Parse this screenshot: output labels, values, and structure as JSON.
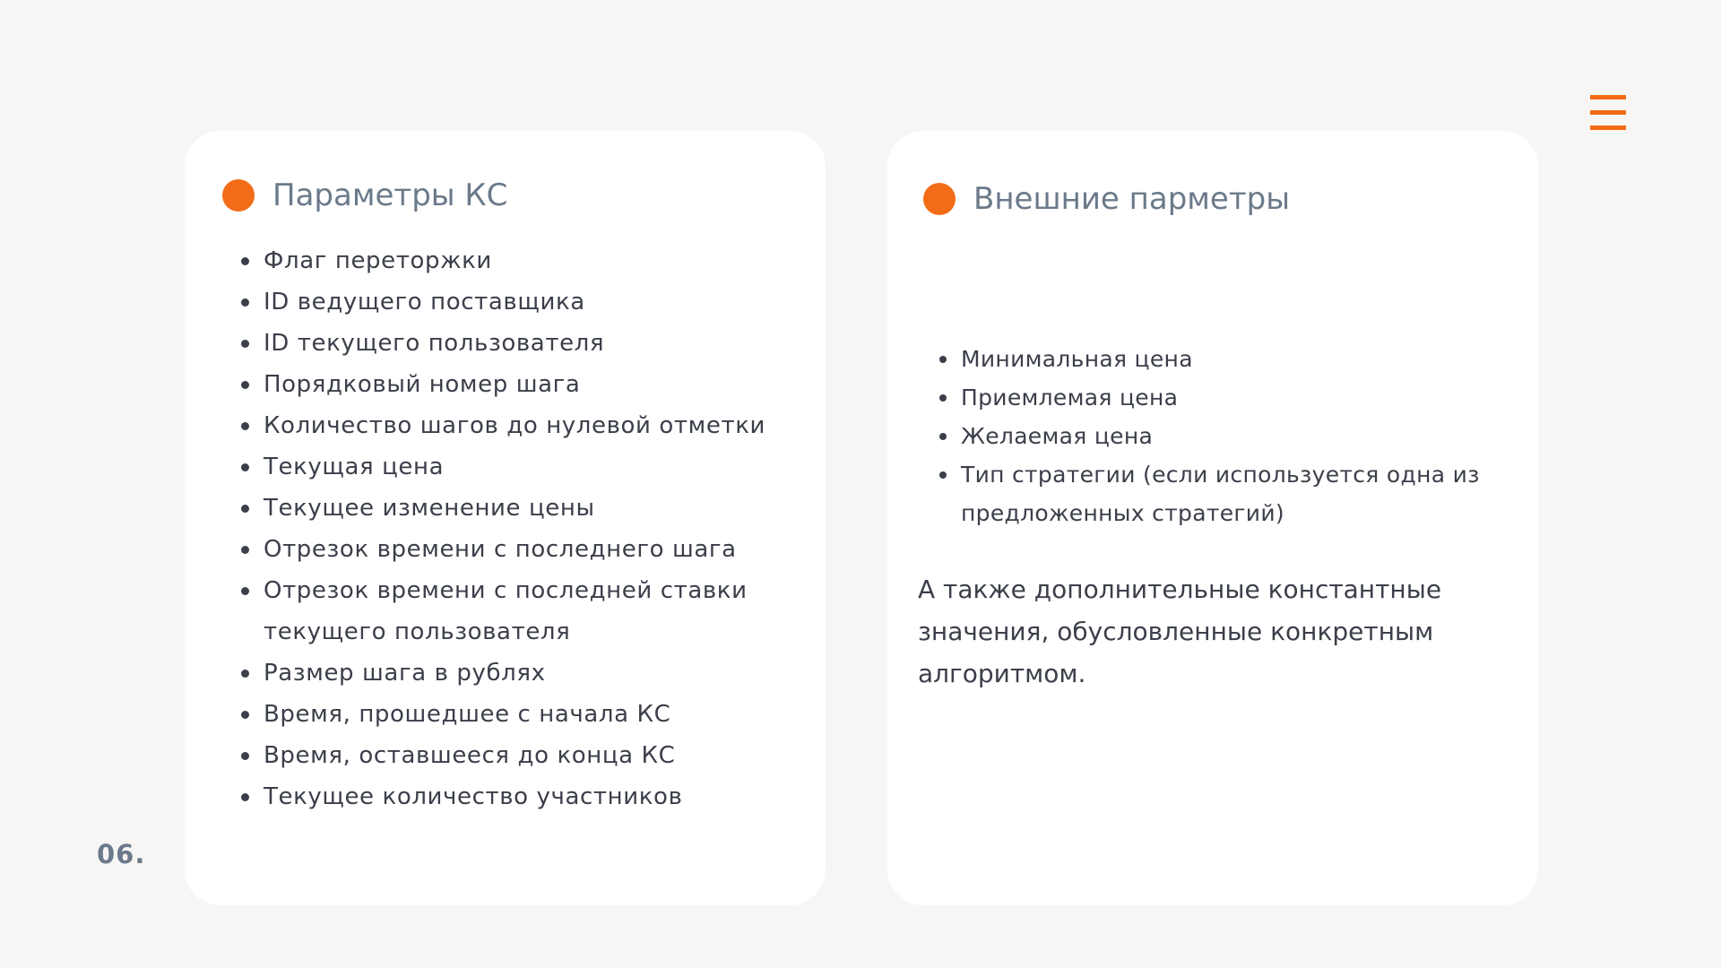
{
  "left_card": {
    "title": "Параметры КС",
    "items": [
      "Флаг переторжки",
      "ID ведущего поставщика",
      "ID текущего пользователя",
      "Порядковый номер шага",
      "Количество шагов до нулевой отметки",
      "Текущая цена",
      "Текущее изменение цены",
      "Отрезок времени с последнего шага",
      "Отрезок времени с последней ставки",
      "текущего пользователя",
      "Размер шага в рублях",
      "Время, прошедшее с начала КС",
      "Время, оставшееся до конца КС",
      "Текущее количество участников"
    ]
  },
  "right_card": {
    "title": "Внешние парметры",
    "items": [
      "Минимальная цена",
      "Приемлемая цена",
      "Желаемая цена",
      "Тип стратегии (если используется одна из",
      "предложенных стратегий)"
    ],
    "note": "А также дополнительные константные\nзначения, обусловленные конкретным\nалгоритмом."
  },
  "page_number": "06.",
  "menu_icon": "hamburger-menu-icon",
  "colors": {
    "accent": "#f26c17",
    "title": "#6b7a8a",
    "text": "#3b3f4a",
    "background": "#f7f6f4",
    "card": "#ffffff"
  }
}
